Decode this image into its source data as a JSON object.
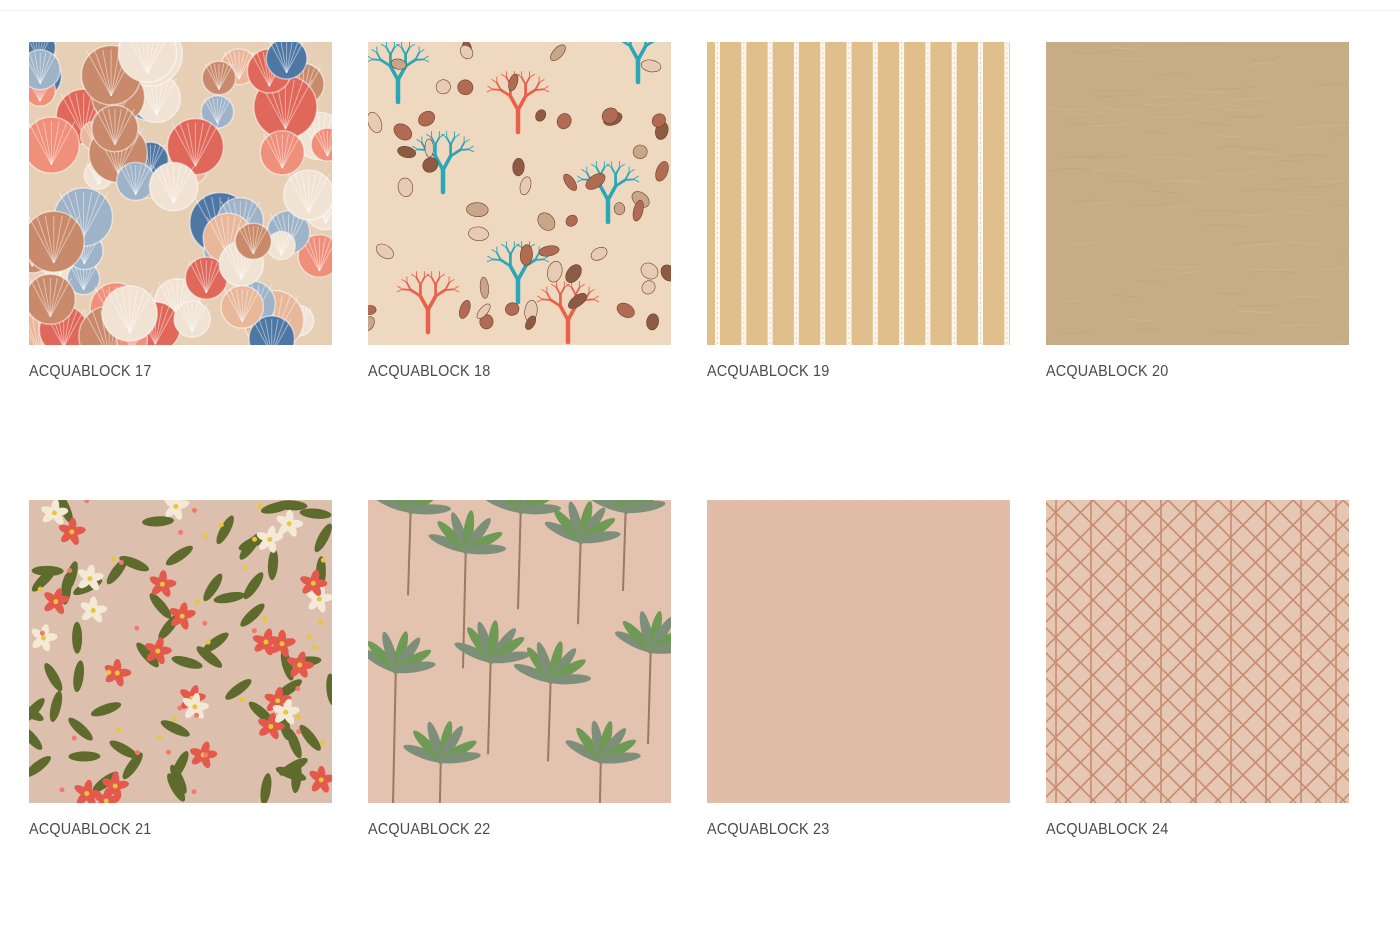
{
  "products": [
    {
      "name": "ACQUABLOCK 17",
      "pattern": "seashells-collage",
      "colors": {
        "bg": "#e7cfb6",
        "a": "#e0685a",
        "b": "#4f77a4",
        "c": "#f1e3d4",
        "d": "#c98a6b"
      }
    },
    {
      "name": "ACQUABLOCK 18",
      "pattern": "coral-and-shells",
      "colors": {
        "bg": "#efd8c0",
        "a": "#2aa6b7",
        "b": "#e8614c",
        "c": "#8d5a44",
        "d": "#c7a689"
      }
    },
    {
      "name": "ACQUABLOCK 19",
      "pattern": "vertical-stripes",
      "colors": {
        "bg": "#e0bf8c",
        "a": "#fbf6ee",
        "b": "#d7b27d"
      }
    },
    {
      "name": "ACQUABLOCK 20",
      "pattern": "plain-leather",
      "colors": {
        "bg": "#c7ad85",
        "a": "#bda17a",
        "b": "#d1b992"
      }
    },
    {
      "name": "ACQUABLOCK 21",
      "pattern": "tropical-orchids",
      "colors": {
        "bg": "#ddbfae",
        "a": "#e35a4c",
        "b": "#5e6b2d",
        "c": "#f4e9d6",
        "d": "#e8c63a"
      }
    },
    {
      "name": "ACQUABLOCK 22",
      "pattern": "palm-trees",
      "colors": {
        "bg": "#e3c2b0",
        "a": "#6e9a55",
        "b": "#7d8f79",
        "c": "#9b7a5e"
      }
    },
    {
      "name": "ACQUABLOCK 23",
      "pattern": "plain-linen",
      "colors": {
        "bg": "#e2bea9",
        "a": "#ddb8a2"
      }
    },
    {
      "name": "ACQUABLOCK 24",
      "pattern": "diamond-lattice",
      "colors": {
        "bg": "#e6c7b3",
        "a": "#c88c70"
      }
    }
  ]
}
